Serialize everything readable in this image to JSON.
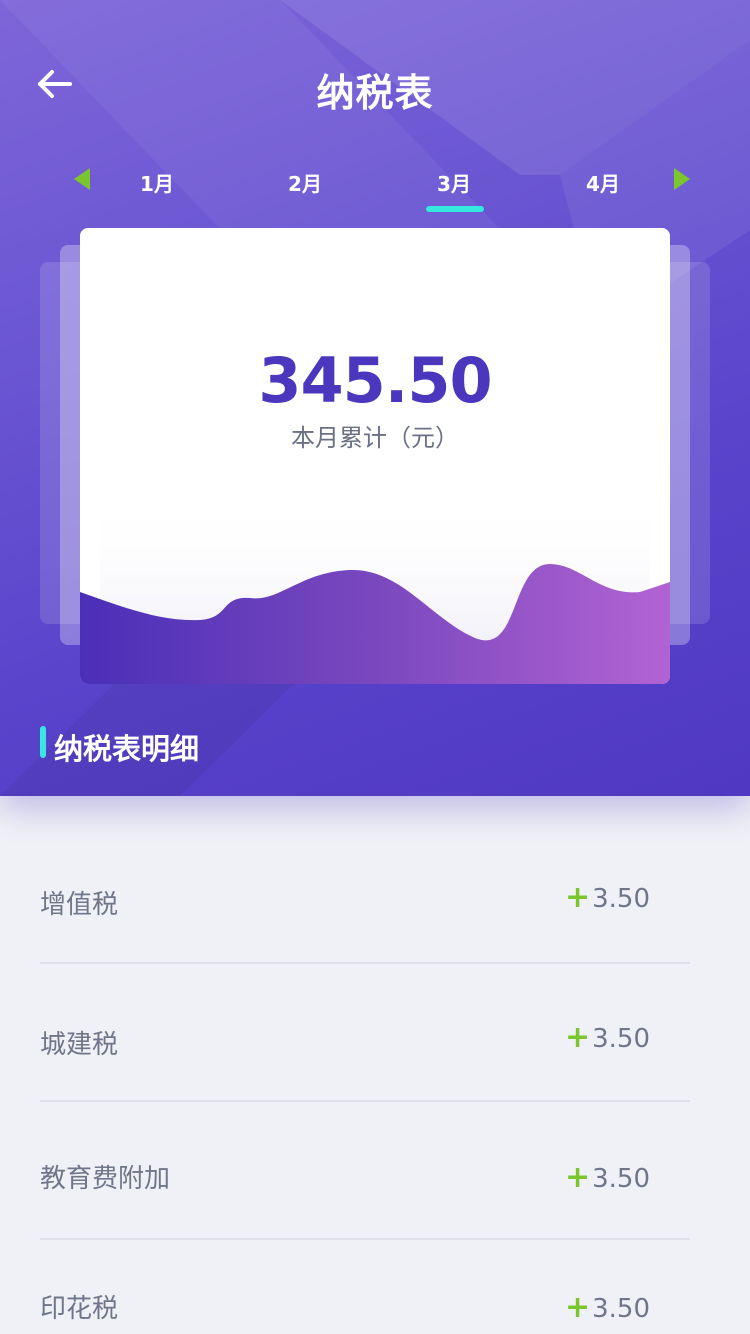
{
  "header": {
    "title": "纳税表"
  },
  "months": {
    "tabs": [
      {
        "label": "1月"
      },
      {
        "label": "2月"
      },
      {
        "label": "3月"
      },
      {
        "label": "4月"
      }
    ],
    "selected_label": "3月"
  },
  "summary": {
    "amount": "345.50",
    "label": "本月累计（元）"
  },
  "section": {
    "title": "纳税表明细"
  },
  "items": [
    {
      "name": "增值税",
      "sign": "+",
      "value": "3.50"
    },
    {
      "name": "城建税",
      "sign": "+",
      "value": "3.50"
    },
    {
      "name": "教育费附加",
      "sign": "+",
      "value": "3.50"
    },
    {
      "name": "印花税",
      "sign": "+",
      "value": "3.50"
    }
  ],
  "colors": {
    "header_gradient": [
      "#7E66D9",
      "#5038C2"
    ],
    "accent_cyan": "#35E8E0",
    "accent_green": "#7BC62D",
    "amount_text": "#4A37BE"
  },
  "icons": {
    "back": "arrow-left-icon",
    "prev": "triangle-left-icon",
    "next": "triangle-right-icon"
  }
}
